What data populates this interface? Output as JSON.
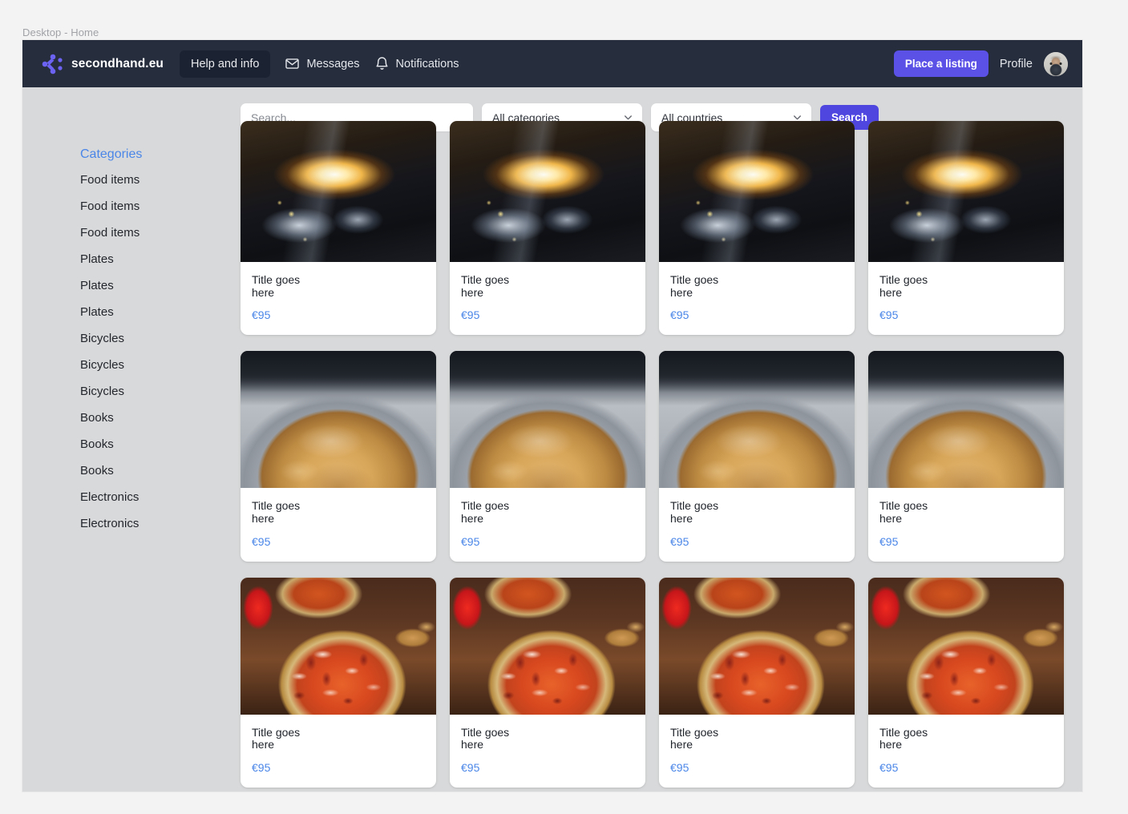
{
  "desktop": {
    "window_title": "Desktop - Home"
  },
  "header": {
    "brand": "secondhand.eu",
    "logo_icon": "dot-cluster-logo-icon",
    "help_label": "Help and info",
    "messages_label": "Messages",
    "messages_icon": "envelope-icon",
    "notifications_label": "Notifications",
    "notifications_icon": "bell-icon",
    "place_listing_label": "Place a listing",
    "profile_label": "Profile",
    "avatar_alt": "avatar",
    "bg_color": "#262d3d",
    "accent_color": "#5b51e6"
  },
  "search": {
    "placeholder": "Search...",
    "value": "",
    "category_select": "All categories",
    "country_select": "All countries",
    "button_label": "Search",
    "chevron_icon": "chevron-down-icon"
  },
  "sidebar": {
    "heading": "Categories",
    "heading_color": "#4a86e8",
    "items": [
      {
        "label": "Food items"
      },
      {
        "label": "Food items"
      },
      {
        "label": "Food items"
      },
      {
        "label": "Plates"
      },
      {
        "label": "Plates"
      },
      {
        "label": "Plates"
      },
      {
        "label": "Bicycles"
      },
      {
        "label": "Bicycles"
      },
      {
        "label": "Bicycles"
      },
      {
        "label": "Books"
      },
      {
        "label": "Books"
      },
      {
        "label": "Books"
      },
      {
        "label": "Electronics"
      },
      {
        "label": "Electronics"
      }
    ]
  },
  "listings": {
    "price_color": "#4a86e8",
    "rows": [
      {
        "image": "car-headlight-at-night",
        "cards": [
          {
            "title": "Title goes here",
            "price": "€95"
          },
          {
            "title": "Title goes here",
            "price": "€95"
          },
          {
            "title": "Title goes here",
            "price": "€95"
          },
          {
            "title": "Title goes here",
            "price": "€95"
          }
        ]
      },
      {
        "image": "crepe-in-steel-pan",
        "cards": [
          {
            "title": "Title goes here",
            "price": "€95"
          },
          {
            "title": "Title goes here",
            "price": "€95"
          },
          {
            "title": "Title goes here",
            "price": "€95"
          },
          {
            "title": "Title goes here",
            "price": "€95"
          }
        ]
      },
      {
        "image": "pizza-on-wooden-board",
        "cards": [
          {
            "title": "Title goes here",
            "price": "€95"
          },
          {
            "title": "Title goes here",
            "price": "€95"
          },
          {
            "title": "Title goes here",
            "price": "€95"
          },
          {
            "title": "Title goes here",
            "price": "€95"
          }
        ]
      }
    ]
  }
}
